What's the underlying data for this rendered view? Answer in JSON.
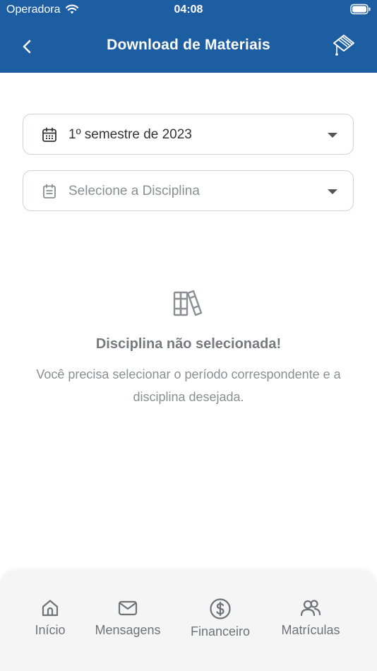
{
  "status_bar": {
    "carrier": "Operadora",
    "time": "04:08"
  },
  "header": {
    "title": "Download de Materiais",
    "color": "#1d5ea3"
  },
  "filters": {
    "period": {
      "value": "1º semestre de 2023"
    },
    "discipline": {
      "placeholder": "Selecione a Disciplina"
    }
  },
  "empty_state": {
    "title": "Disciplina não selecionada!",
    "description": "Você precisa selecionar o período correspondente e a disciplina desejada."
  },
  "tabbar": {
    "items": [
      {
        "label": "Início",
        "icon": "home-icon"
      },
      {
        "label": "Mensagens",
        "icon": "mail-icon"
      },
      {
        "label": "Financeiro",
        "icon": "dollar-icon"
      },
      {
        "label": "Matrículas",
        "icon": "users-icon"
      }
    ]
  }
}
